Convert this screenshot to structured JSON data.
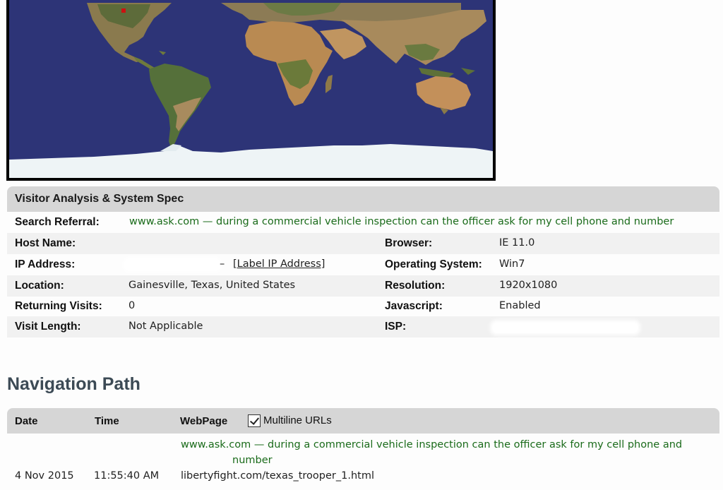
{
  "panel": {
    "title": "Visitor Analysis & System Spec",
    "search_referral": {
      "label": "Search Referral:",
      "value": "www.ask.com — during a commercial vehicle inspection can the officer ask for my cell phone and number"
    },
    "host_name": {
      "label": "Host Name:",
      "value": ""
    },
    "ip_address": {
      "label": "IP Address:",
      "separator": "–",
      "link": "[Label IP Address]"
    },
    "location": {
      "label": "Location:",
      "value": "Gainesville, Texas, United States"
    },
    "returning_visits": {
      "label": "Returning Visits:",
      "value": "0"
    },
    "visit_length": {
      "label": "Visit Length:",
      "value": "Not Applicable"
    },
    "browser": {
      "label": "Browser:",
      "value": "IE 11.0"
    },
    "operating_system": {
      "label": "Operating System:",
      "value": "Win7"
    },
    "resolution": {
      "label": "Resolution:",
      "value": "1920x1080"
    },
    "javascript": {
      "label": "Javascript:",
      "value": "Enabled"
    },
    "isp": {
      "label": "ISP:",
      "value": ""
    }
  },
  "navigation": {
    "title": "Navigation Path",
    "columns": {
      "date": "Date",
      "time": "Time",
      "webpage": "WebPage"
    },
    "multiline_label": "Multiline URLs",
    "multiline_checked": true,
    "entries": [
      {
        "referral_line1": "www.ask.com — during a commercial vehicle inspection can the officer ask for my cell phone and",
        "referral_line2": "number",
        "date": "4 Nov 2015",
        "time": "11:55:40 AM",
        "webpage": "libertyfight.com/texas_trooper_1.html"
      }
    ]
  },
  "map": {
    "ocean_color": "#2d3477",
    "land_color": "#b08a5a",
    "ice_color": "#eef4f6",
    "marker_color": "#cc1111"
  }
}
